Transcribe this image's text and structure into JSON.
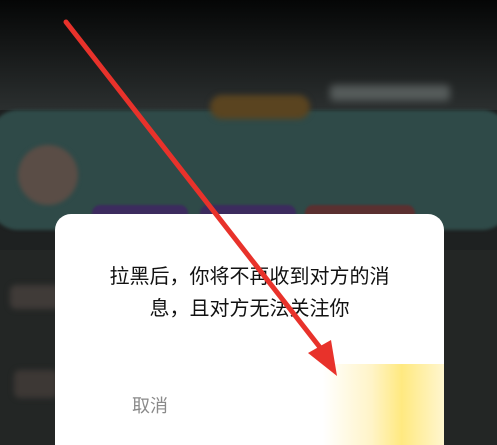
{
  "dialog": {
    "message_line1": "拉黑后，你将不再收到对方的消",
    "message_line2": "息，且对方无法关注你",
    "cancel_label": "取消",
    "confirm_label": ""
  },
  "colors": {
    "annotation_arrow": "#e8322b",
    "dialog_bg": "#ffffff",
    "confirm_highlight": "#ffe980"
  }
}
